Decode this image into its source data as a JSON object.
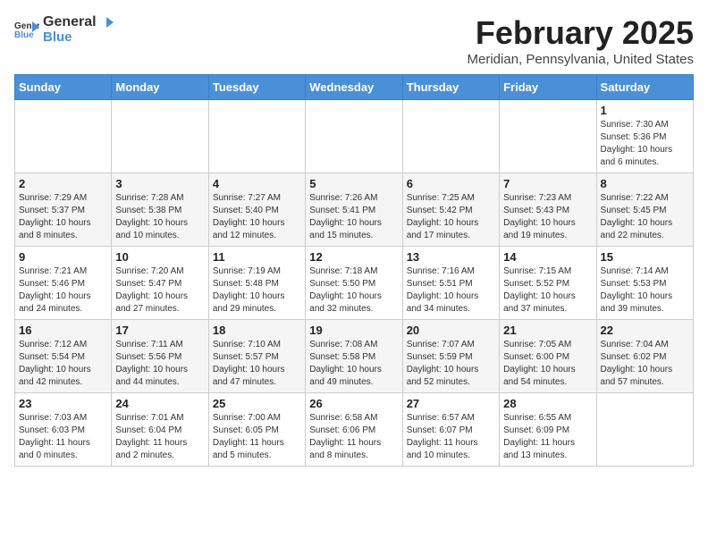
{
  "header": {
    "logo_general": "General",
    "logo_blue": "Blue",
    "month_title": "February 2025",
    "location": "Meridian, Pennsylvania, United States"
  },
  "calendar": {
    "days_of_week": [
      "Sunday",
      "Monday",
      "Tuesday",
      "Wednesday",
      "Thursday",
      "Friday",
      "Saturday"
    ],
    "weeks": [
      [
        {
          "day": "",
          "info": ""
        },
        {
          "day": "",
          "info": ""
        },
        {
          "day": "",
          "info": ""
        },
        {
          "day": "",
          "info": ""
        },
        {
          "day": "",
          "info": ""
        },
        {
          "day": "",
          "info": ""
        },
        {
          "day": "1",
          "info": "Sunrise: 7:30 AM\nSunset: 5:36 PM\nDaylight: 10 hours\nand 6 minutes."
        }
      ],
      [
        {
          "day": "2",
          "info": "Sunrise: 7:29 AM\nSunset: 5:37 PM\nDaylight: 10 hours\nand 8 minutes."
        },
        {
          "day": "3",
          "info": "Sunrise: 7:28 AM\nSunset: 5:38 PM\nDaylight: 10 hours\nand 10 minutes."
        },
        {
          "day": "4",
          "info": "Sunrise: 7:27 AM\nSunset: 5:40 PM\nDaylight: 10 hours\nand 12 minutes."
        },
        {
          "day": "5",
          "info": "Sunrise: 7:26 AM\nSunset: 5:41 PM\nDaylight: 10 hours\nand 15 minutes."
        },
        {
          "day": "6",
          "info": "Sunrise: 7:25 AM\nSunset: 5:42 PM\nDaylight: 10 hours\nand 17 minutes."
        },
        {
          "day": "7",
          "info": "Sunrise: 7:23 AM\nSunset: 5:43 PM\nDaylight: 10 hours\nand 19 minutes."
        },
        {
          "day": "8",
          "info": "Sunrise: 7:22 AM\nSunset: 5:45 PM\nDaylight: 10 hours\nand 22 minutes."
        }
      ],
      [
        {
          "day": "9",
          "info": "Sunrise: 7:21 AM\nSunset: 5:46 PM\nDaylight: 10 hours\nand 24 minutes."
        },
        {
          "day": "10",
          "info": "Sunrise: 7:20 AM\nSunset: 5:47 PM\nDaylight: 10 hours\nand 27 minutes."
        },
        {
          "day": "11",
          "info": "Sunrise: 7:19 AM\nSunset: 5:48 PM\nDaylight: 10 hours\nand 29 minutes."
        },
        {
          "day": "12",
          "info": "Sunrise: 7:18 AM\nSunset: 5:50 PM\nDaylight: 10 hours\nand 32 minutes."
        },
        {
          "day": "13",
          "info": "Sunrise: 7:16 AM\nSunset: 5:51 PM\nDaylight: 10 hours\nand 34 minutes."
        },
        {
          "day": "14",
          "info": "Sunrise: 7:15 AM\nSunset: 5:52 PM\nDaylight: 10 hours\nand 37 minutes."
        },
        {
          "day": "15",
          "info": "Sunrise: 7:14 AM\nSunset: 5:53 PM\nDaylight: 10 hours\nand 39 minutes."
        }
      ],
      [
        {
          "day": "16",
          "info": "Sunrise: 7:12 AM\nSunset: 5:54 PM\nDaylight: 10 hours\nand 42 minutes."
        },
        {
          "day": "17",
          "info": "Sunrise: 7:11 AM\nSunset: 5:56 PM\nDaylight: 10 hours\nand 44 minutes."
        },
        {
          "day": "18",
          "info": "Sunrise: 7:10 AM\nSunset: 5:57 PM\nDaylight: 10 hours\nand 47 minutes."
        },
        {
          "day": "19",
          "info": "Sunrise: 7:08 AM\nSunset: 5:58 PM\nDaylight: 10 hours\nand 49 minutes."
        },
        {
          "day": "20",
          "info": "Sunrise: 7:07 AM\nSunset: 5:59 PM\nDaylight: 10 hours\nand 52 minutes."
        },
        {
          "day": "21",
          "info": "Sunrise: 7:05 AM\nSunset: 6:00 PM\nDaylight: 10 hours\nand 54 minutes."
        },
        {
          "day": "22",
          "info": "Sunrise: 7:04 AM\nSunset: 6:02 PM\nDaylight: 10 hours\nand 57 minutes."
        }
      ],
      [
        {
          "day": "23",
          "info": "Sunrise: 7:03 AM\nSunset: 6:03 PM\nDaylight: 11 hours\nand 0 minutes."
        },
        {
          "day": "24",
          "info": "Sunrise: 7:01 AM\nSunset: 6:04 PM\nDaylight: 11 hours\nand 2 minutes."
        },
        {
          "day": "25",
          "info": "Sunrise: 7:00 AM\nSunset: 6:05 PM\nDaylight: 11 hours\nand 5 minutes."
        },
        {
          "day": "26",
          "info": "Sunrise: 6:58 AM\nSunset: 6:06 PM\nDaylight: 11 hours\nand 8 minutes."
        },
        {
          "day": "27",
          "info": "Sunrise: 6:57 AM\nSunset: 6:07 PM\nDaylight: 11 hours\nand 10 minutes."
        },
        {
          "day": "28",
          "info": "Sunrise: 6:55 AM\nSunset: 6:09 PM\nDaylight: 11 hours\nand 13 minutes."
        },
        {
          "day": "",
          "info": ""
        }
      ]
    ]
  }
}
